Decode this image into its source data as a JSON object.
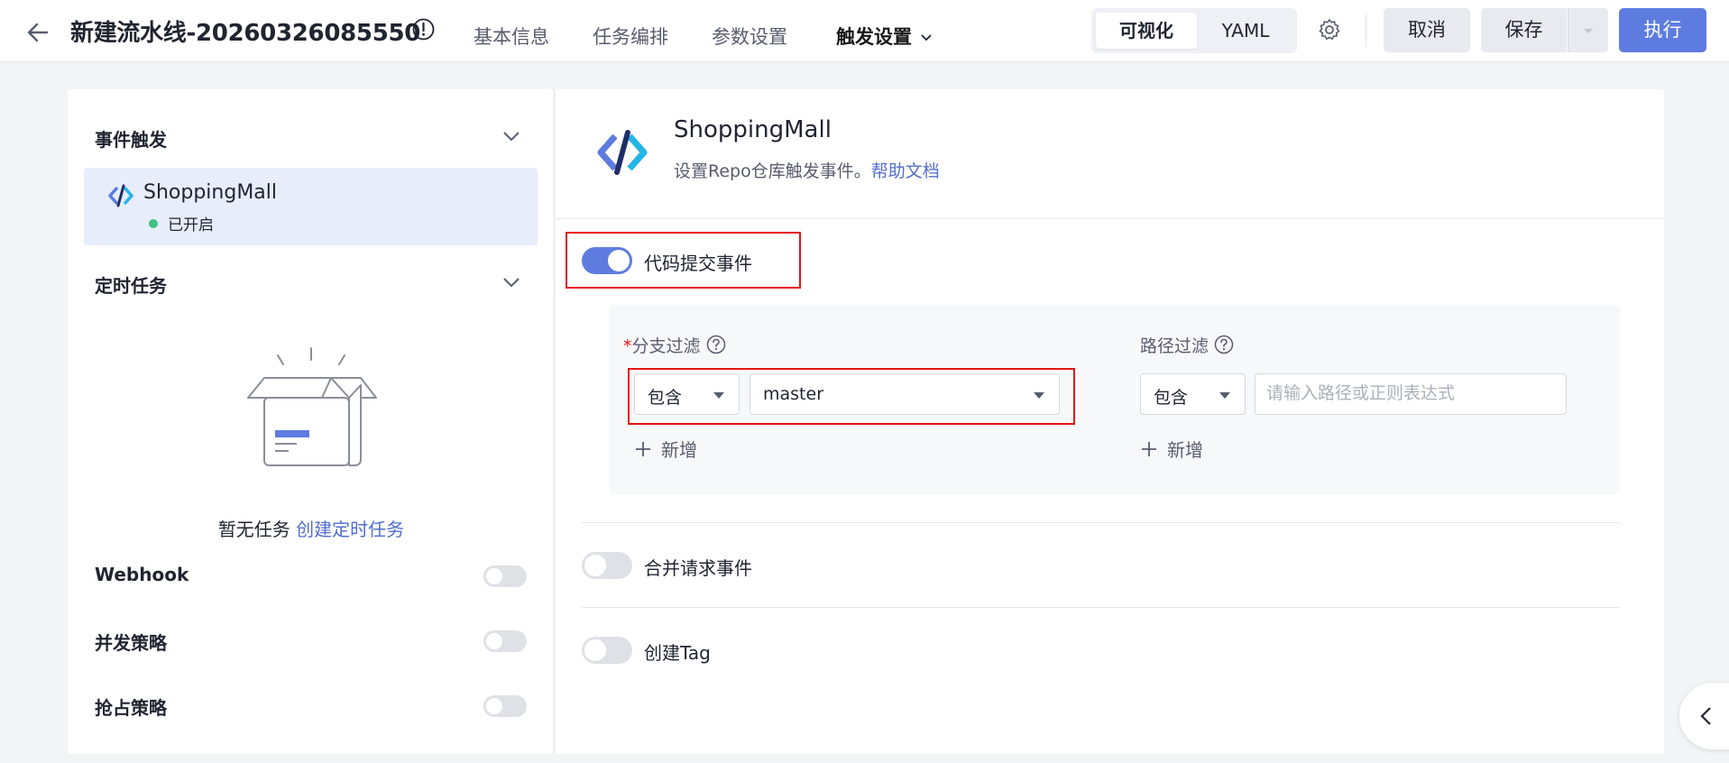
{
  "header": {
    "title": "新建流水线-20260326085550",
    "tabs": [
      {
        "label": "基本信息"
      },
      {
        "label": "任务编排"
      },
      {
        "label": "参数设置"
      },
      {
        "label": "触发设置"
      }
    ],
    "view_modes": [
      "可视化",
      "YAML"
    ],
    "cancel_label": "取消",
    "save_label": "保存",
    "run_label": "执行"
  },
  "sidebar": {
    "event_trigger_title": "事件触发",
    "repo_name": "ShoppingMall",
    "repo_status": "已开启",
    "scheduled_title": "定时任务",
    "empty_text": "暂无任务",
    "create_link": "创建定时任务",
    "options": [
      {
        "label": "Webhook",
        "enabled": false
      },
      {
        "label": "并发策略",
        "enabled": false
      },
      {
        "label": "抢占策略",
        "enabled": false
      }
    ]
  },
  "detail": {
    "repo_name": "ShoppingMall",
    "subtitle": "设置Repo仓库触发事件。",
    "help_link": "帮助文档",
    "push_event_label": "代码提交事件",
    "push_event_enabled": true,
    "branch_filter_label": "分支过滤",
    "branch_mode": "包含",
    "branch_value": "master",
    "path_filter_label": "路径过滤",
    "path_mode": "包含",
    "path_placeholder": "请输入路径或正则表达式",
    "add_label": "新增",
    "merge_event_label": "合并请求事件",
    "merge_event_enabled": false,
    "tag_event_label": "创建Tag",
    "tag_event_enabled": false
  },
  "colors": {
    "primary": "#5e7ce0",
    "highlight_border": "#e61414",
    "status_green": "#3ec181"
  }
}
